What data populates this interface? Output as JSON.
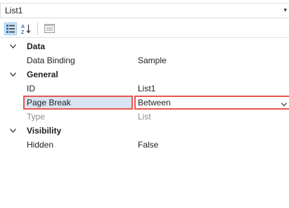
{
  "object_selector": {
    "value": "List1"
  },
  "toolbar": {
    "categorized_icon": "categorized-icon",
    "alphabetical_icon": "alphabetical-sort-icon",
    "property_pages_icon": "property-pages-icon"
  },
  "categories": [
    {
      "label": "Data",
      "properties": [
        {
          "name": "Data Binding",
          "value": "Sample"
        }
      ]
    },
    {
      "label": "General",
      "properties": [
        {
          "name": "ID",
          "value": "List1"
        },
        {
          "name": "Page Break",
          "value": "Between"
        },
        {
          "name": "Type",
          "value": "List"
        }
      ]
    },
    {
      "label": "Visibility",
      "properties": [
        {
          "name": "Hidden",
          "value": "False"
        }
      ]
    }
  ],
  "colors": {
    "highlight_border": "#e8554e",
    "selected_row_fill": "#d9e4f2",
    "disabled_text": "#8a8a8a"
  }
}
